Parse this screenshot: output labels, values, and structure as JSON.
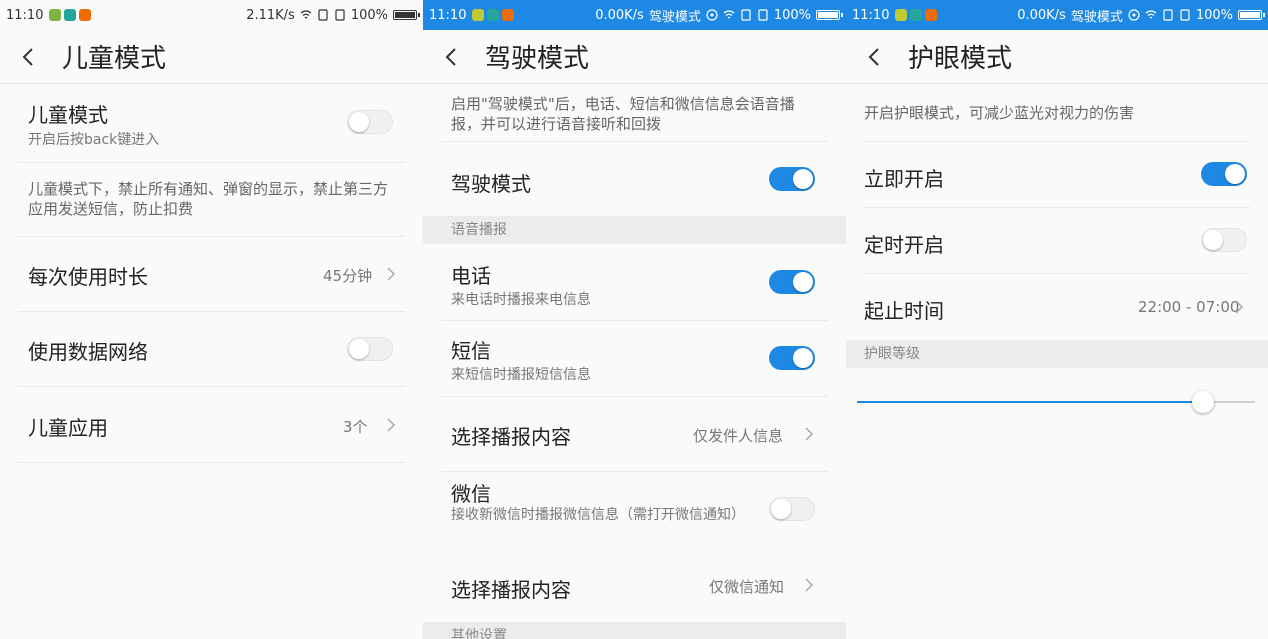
{
  "colors": {
    "accent": "#1e88e5",
    "statusbar_blue": "#1e88e5",
    "toggle_off": "#f0f0f0"
  },
  "kids": {
    "status": {
      "time": "11:10",
      "speed": "2.11K/s",
      "battery": "100%"
    },
    "title": "儿童模式",
    "mode_row": {
      "label": "儿童模式",
      "sub": "开启后按back键进入",
      "on": false
    },
    "desc": "儿童模式下，禁止所有通知、弹窗的显示，禁止第三方应用发送短信，防止扣费",
    "duration": {
      "label": "每次使用时长",
      "value": "45分钟"
    },
    "data_network": {
      "label": "使用数据网络",
      "on": false
    },
    "apps": {
      "label": "儿童应用",
      "value": "3个"
    }
  },
  "driving": {
    "status": {
      "time": "11:10",
      "speed": "0.00K/s",
      "mode": "驾驶模式",
      "battery": "100%"
    },
    "title": "驾驶模式",
    "desc": "启用\"驾驶模式\"后，电话、短信和微信信息会语音播报，并可以进行语音接听和回拨",
    "mode_row": {
      "label": "驾驶模式",
      "on": true
    },
    "section_voice": "语音播报",
    "phone": {
      "label": "电话",
      "sub": "来电话时播报来电信息",
      "on": true
    },
    "sms": {
      "label": "短信",
      "sub": "来短信时播报短信信息",
      "on": true
    },
    "sms_content": {
      "label": "选择播报内容",
      "value": "仅发件人信息"
    },
    "wechat": {
      "label": "微信",
      "sub": "接收新微信时播报微信信息（需打开微信通知）",
      "on": false
    },
    "wechat_content": {
      "label": "选择播报内容",
      "value": "仅微信通知"
    },
    "section_other": "其他设置"
  },
  "eye": {
    "status": {
      "time": "11:10",
      "speed": "0.00K/s",
      "mode": "驾驶模式",
      "battery": "100%"
    },
    "title": "护眼模式",
    "desc": "开启护眼模式，可减少蓝光对视力的伤害",
    "now": {
      "label": "立即开启",
      "on": true
    },
    "scheduled": {
      "label": "定时开启",
      "on": false
    },
    "time_range": {
      "label": "起止时间",
      "value": "22:00 - 07:00"
    },
    "section_level": "护眼等级",
    "level_fraction": 0.87
  }
}
